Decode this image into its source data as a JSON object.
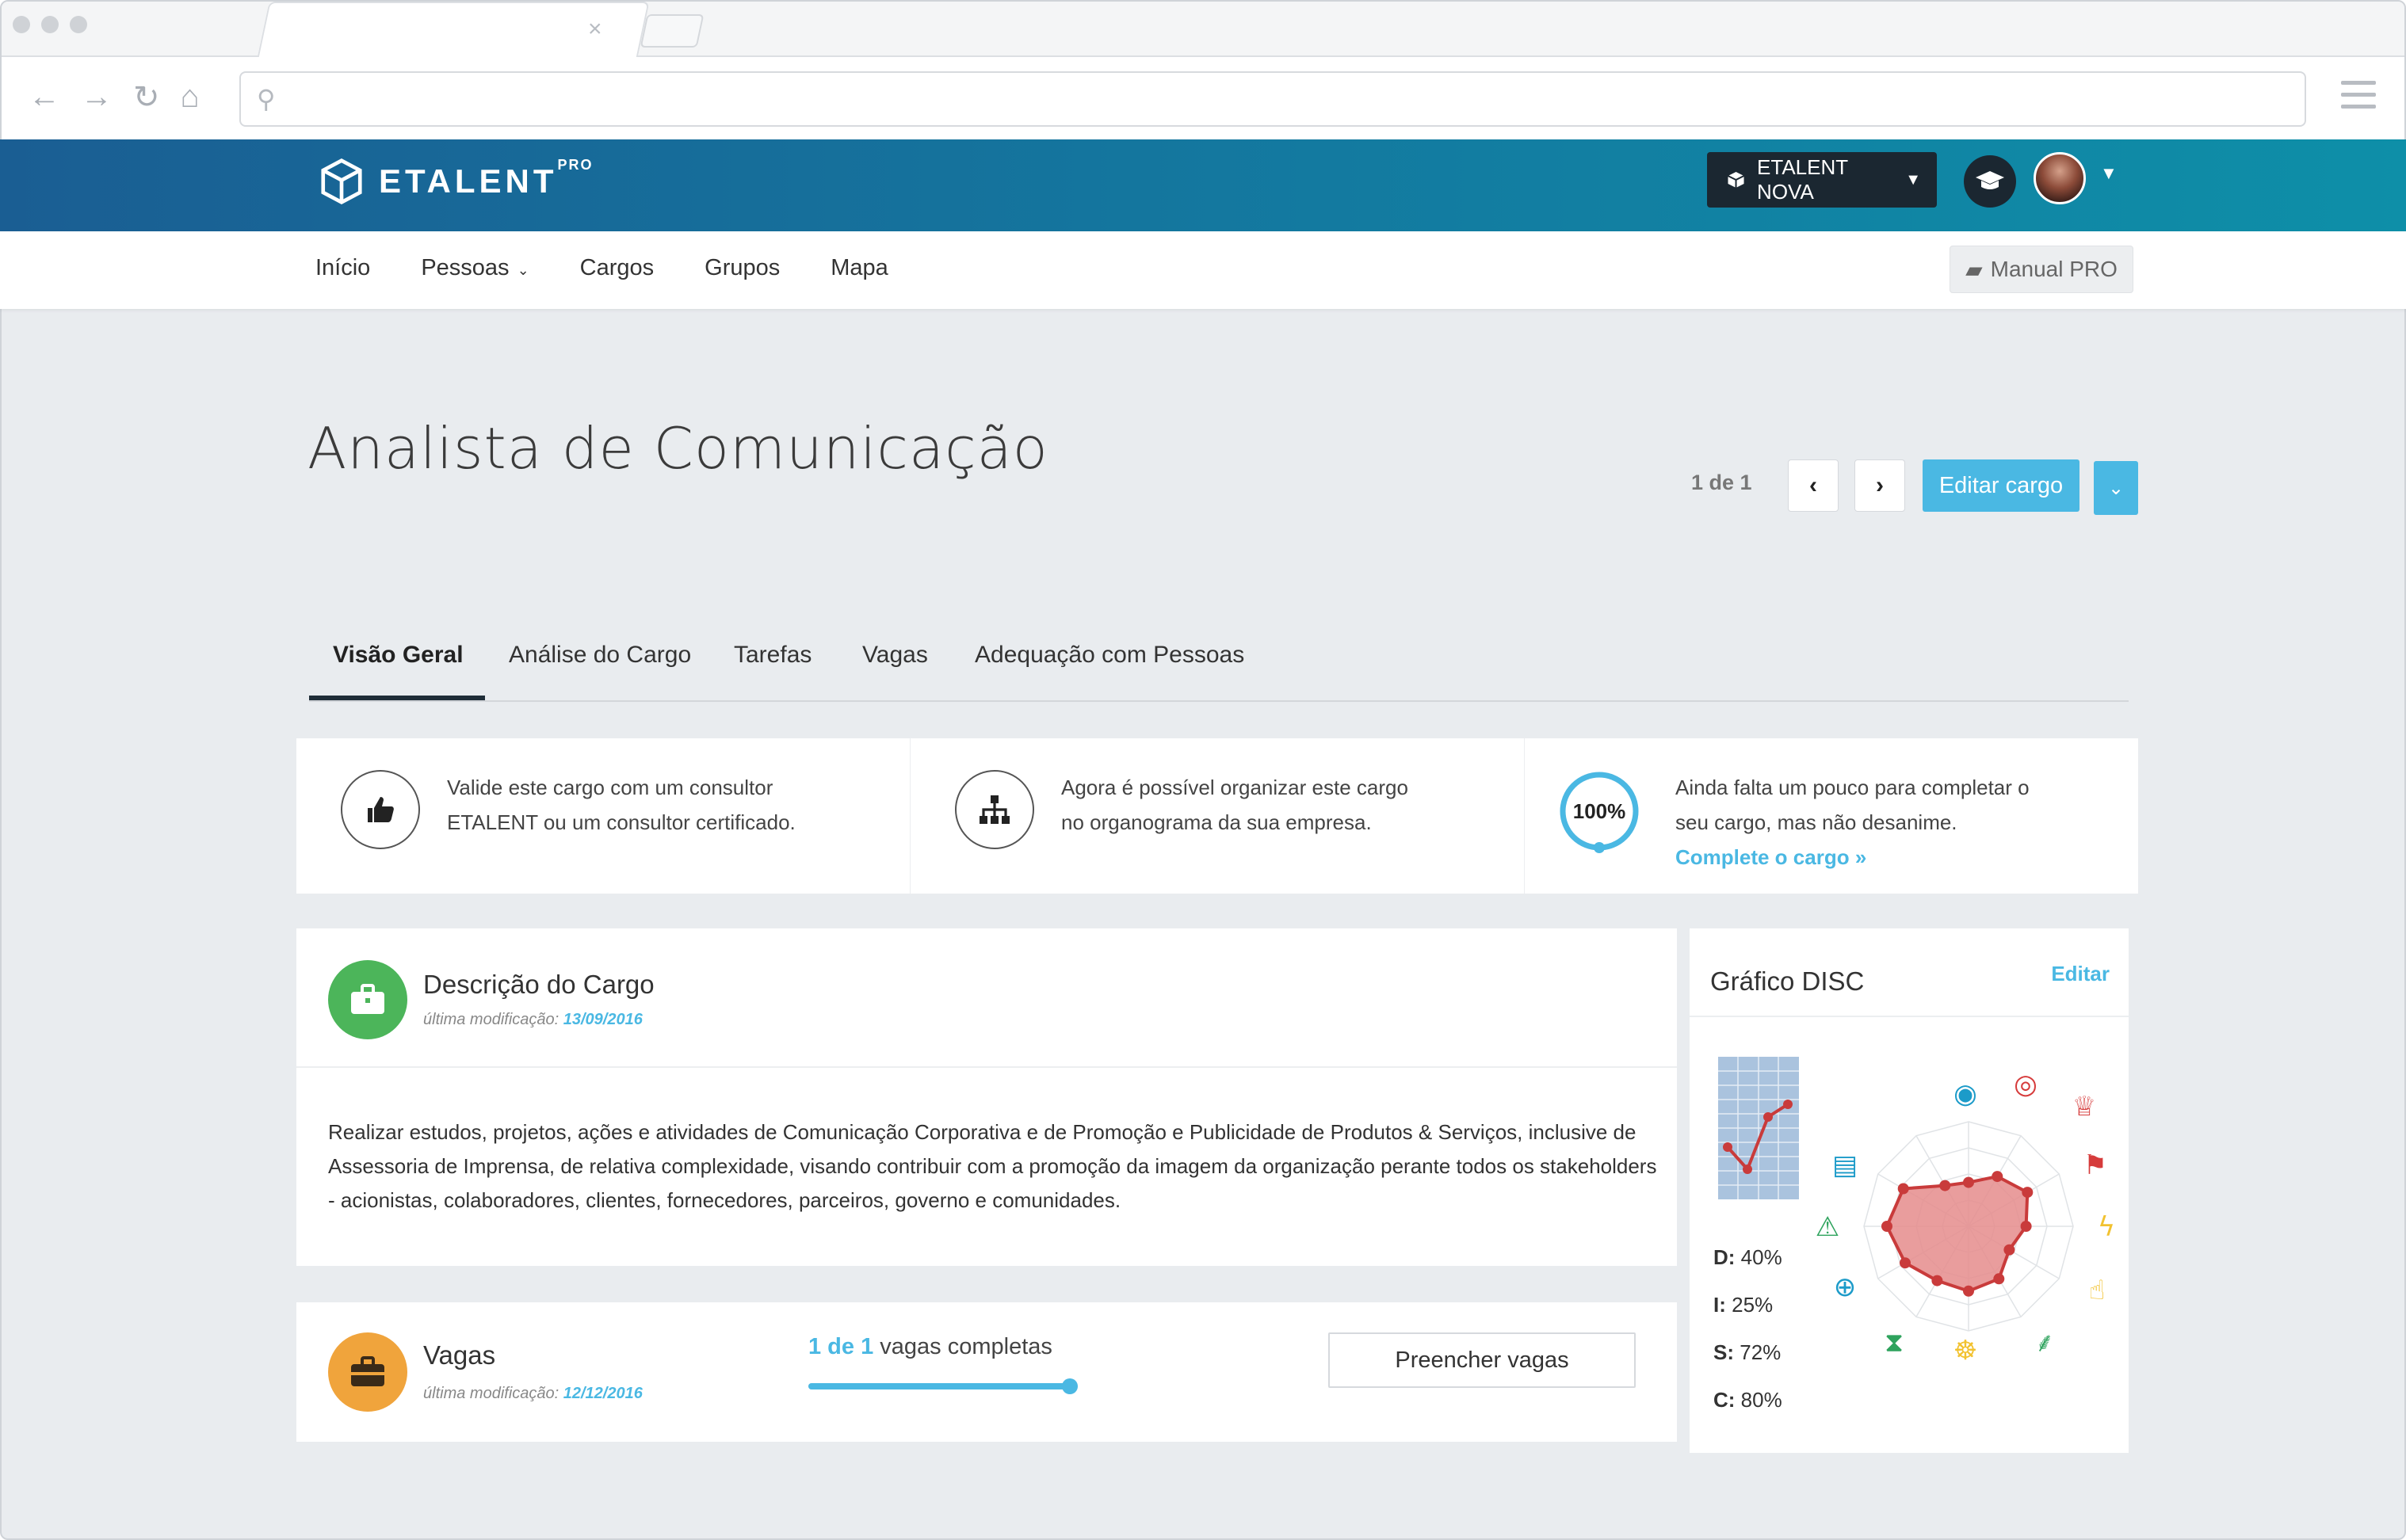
{
  "app": {
    "name": "ETALENT",
    "name_sup": "PRO",
    "company_button": "ETALENT NOVA"
  },
  "menu": {
    "items": [
      "Início",
      "Pessoas",
      "Cargos",
      "Grupos",
      "Mapa"
    ],
    "manual_label": "Manual PRO"
  },
  "page": {
    "title": "Analista de Comunicação",
    "pager": "1 de 1",
    "edit_label": "Editar cargo"
  },
  "tabs": [
    "Visão Geral",
    "Análise do Cargo",
    "Tarefas",
    "Vagas",
    "Adequação com Pessoas"
  ],
  "info": {
    "validate_line1": "Valide este cargo com um consultor",
    "validate_line2": "ETALENT ou um consultor certificado.",
    "org_line1": "Agora é possível organizar este cargo",
    "org_line2": "no organograma da sua empresa.",
    "progress_value": "100%",
    "progress_fraction": 1.0,
    "complete_line1": "Ainda falta um pouco para completar o",
    "complete_line2": "seu cargo, mas não desanime.",
    "complete_link": "Complete o cargo »"
  },
  "description": {
    "title": "Descrição do Cargo",
    "modified_prefix": "última modificação:",
    "modified_date": "13/09/2016",
    "text": "Realizar estudos, projetos, ações e atividades de Comunicação Corporativa e de Promoção e Publicidade de Produtos & Serviços, inclusive de Assessoria de Imprensa, de relativa complexidade, visando contribuir com a promoção da imagem da organização perante todos os stakeholders - acionistas, colaboradores, clientes, fornecedores, parceiros, governo e comunidades.",
    "icon_color": "#4cb55a"
  },
  "vagas": {
    "title": "Vagas",
    "modified_prefix": "última modificação:",
    "modified_date": "12/12/2016",
    "progress_count": "1 de 1",
    "progress_suffix": "vagas completas",
    "progress_fraction": 1.0,
    "fill_label": "Preencher vagas",
    "icon_color": "#f0a43c"
  },
  "disc": {
    "title": "Gráfico DISC",
    "edit_label": "Editar",
    "legend": [
      {
        "key": "D:",
        "value": "40%"
      },
      {
        "key": "I:",
        "value": "25%"
      },
      {
        "key": "S:",
        "value": "72%"
      },
      {
        "key": "C:",
        "value": "80%"
      }
    ]
  },
  "colors": {
    "accent": "#4ab8e3",
    "header_dark": "#1b2731",
    "radar_fill": "#e58c8c",
    "radar_stroke": "#c93b3b"
  }
}
